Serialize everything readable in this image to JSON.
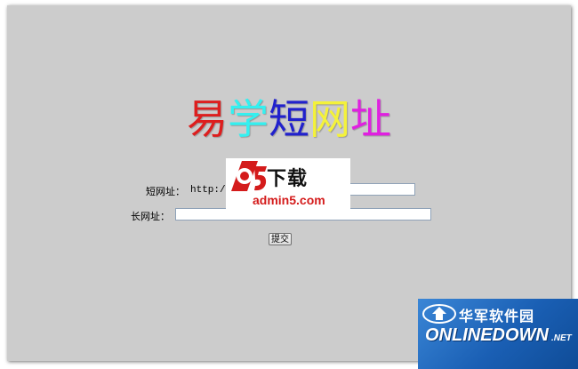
{
  "title": {
    "chars": [
      {
        "text": "易",
        "color": "#dd1e1e"
      },
      {
        "text": "学",
        "color": "#33f0f0"
      },
      {
        "text": "短",
        "color": "#2121cc"
      },
      {
        "text": "网",
        "color": "#f4f23a"
      },
      {
        "text": "址",
        "color": "#e020e0"
      }
    ]
  },
  "form": {
    "short_label": "短网址：",
    "short_prefix": "http://",
    "short_value": "",
    "long_label": "长网址：",
    "long_value": "",
    "submit_label": "提交"
  },
  "watermarks": {
    "a5": {
      "text": "下载",
      "domain": "admin5.com",
      "accent": "#d41b1b"
    },
    "onlinedown": {
      "cn": "华军软件园",
      "en": "ONLINEDOWN",
      "tld": ".NET",
      "bg": "#1a5fb4"
    }
  }
}
